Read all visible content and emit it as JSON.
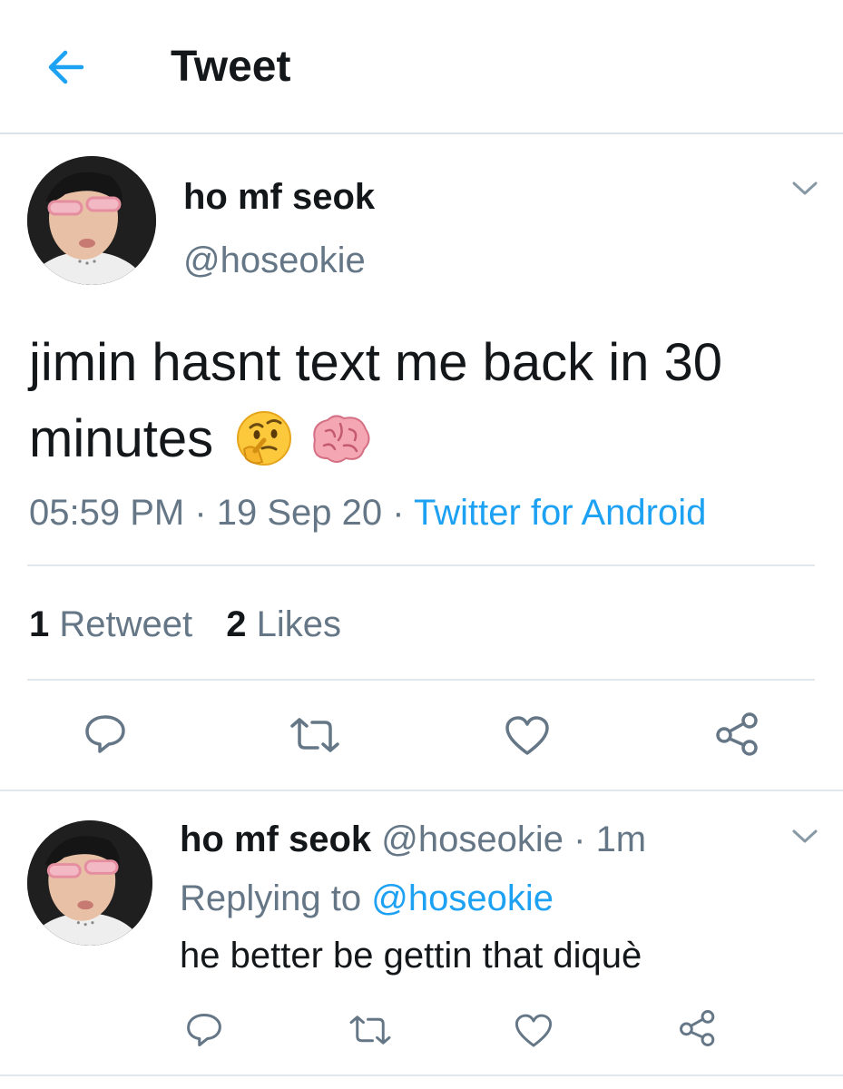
{
  "header": {
    "title": "Tweet",
    "back_icon": "arrow-left-icon",
    "accent": "#1da1f2"
  },
  "tweet": {
    "display_name": "ho mf seok",
    "handle": "@hoseokie",
    "text": "jimin hasnt text me back in 30 minutes",
    "emojis": [
      "thinking-face",
      "brain"
    ],
    "time": "05:59 PM",
    "sep1": " · ",
    "date": "19 Sep 20",
    "sep2": " · ",
    "source": "Twitter for Android",
    "retweet_count": "1",
    "retweet_label": "Retweet",
    "like_count": "2",
    "like_label": "Likes"
  },
  "reply": {
    "display_name": "ho mf seok",
    "handle": "@hoseokie",
    "sep": " · ",
    "age": "1m",
    "replying_prefix": "Replying to ",
    "replying_to": "@hoseokie",
    "text": "he better be gettin that diquè"
  },
  "colors": {
    "text": "#14171a",
    "muted": "#657786",
    "link": "#1da1f2",
    "divider": "#e1e8ed"
  }
}
